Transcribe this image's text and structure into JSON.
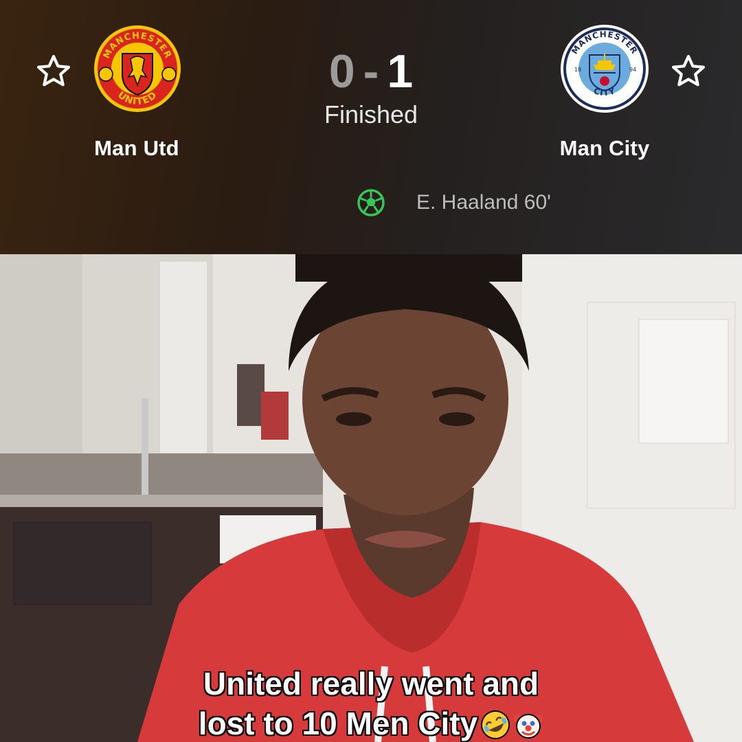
{
  "match": {
    "home_team": "Man Utd",
    "away_team": "Man City",
    "home_score": "0",
    "separator": "-",
    "away_score": "1",
    "status": "Finished",
    "goals": [
      {
        "scorer": "E. Haaland 60'"
      }
    ]
  },
  "crests": {
    "home": {
      "top_text": "MANCHESTER",
      "bottom_text": "UNITED"
    },
    "away": {
      "top_text": "MANCHESTER",
      "bottom_text": "CITY",
      "left_year": "18",
      "right_year": "94"
    }
  },
  "caption": {
    "line1": "United really went and",
    "line2": "lost to 10 Men City"
  },
  "icons": {
    "favorite": "star-outline-icon",
    "goal": "football-icon",
    "emoji_1": "rolling-laughing-emoji",
    "emoji_2": "clown-face-emoji"
  },
  "colors": {
    "goal_icon": "#35c759",
    "home_crest_red": "#d9251d",
    "home_crest_yellow": "#f6c700",
    "away_crest_blue": "#6cabdd",
    "away_crest_navy": "#1c2c5b",
    "hoodie": "#d63a3a"
  }
}
